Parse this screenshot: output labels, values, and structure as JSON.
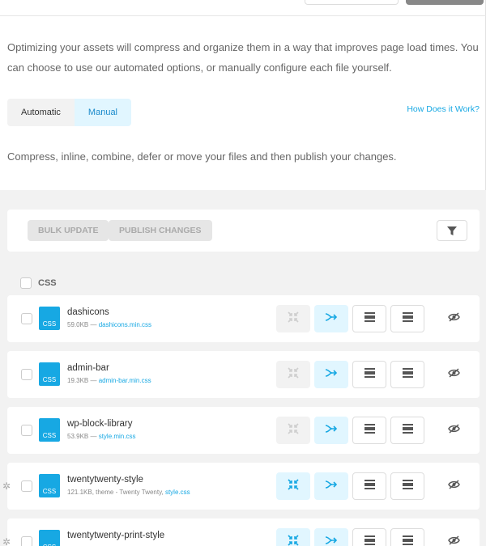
{
  "intro": "Optimizing your assets will compress and organize them in a way that improves page load times. You can choose to use our automated options, or manually configure each file yourself.",
  "tabs": [
    "Automatic",
    "Manual"
  ],
  "active_tab": "Manual",
  "how_link": "How Does it Work?",
  "description": "Compress, inline, combine, defer or move your files and then publish your changes.",
  "toolbar": {
    "bulk_label": "BULK UPDATE",
    "publish_label": "PUBLISH CHANGES"
  },
  "section": {
    "label": "CSS"
  },
  "rows": [
    {
      "name": "dashicons",
      "meta": "59.0KB — ",
      "link": "dashicons.min.css",
      "type": "CSS",
      "compressed": false
    },
    {
      "name": "admin-bar",
      "meta": "19.3KB — ",
      "link": "admin-bar.min.css",
      "type": "CSS",
      "compressed": false
    },
    {
      "name": "wp-block-library",
      "meta": "53.9KB — ",
      "link": "style.min.css",
      "type": "CSS",
      "compressed": false
    },
    {
      "name": "twentytwenty-style",
      "meta": "121.1KB, theme - Twenty Twenty, ",
      "link": "style.css",
      "type": "CSS",
      "compressed": true
    },
    {
      "name": "twentytwenty-print-style",
      "meta": "",
      "link": "",
      "type": "CSS",
      "compressed": true
    }
  ],
  "colors": {
    "accent": "#17a8e3",
    "active_bg": "#e1f6ff",
    "disabled_bg": "#e6e6e6"
  },
  "icons": [
    "filter-icon",
    "compress-icon",
    "combine-icon",
    "inline-icon",
    "defer-icon",
    "eye-off-icon",
    "spinner-icon"
  ]
}
